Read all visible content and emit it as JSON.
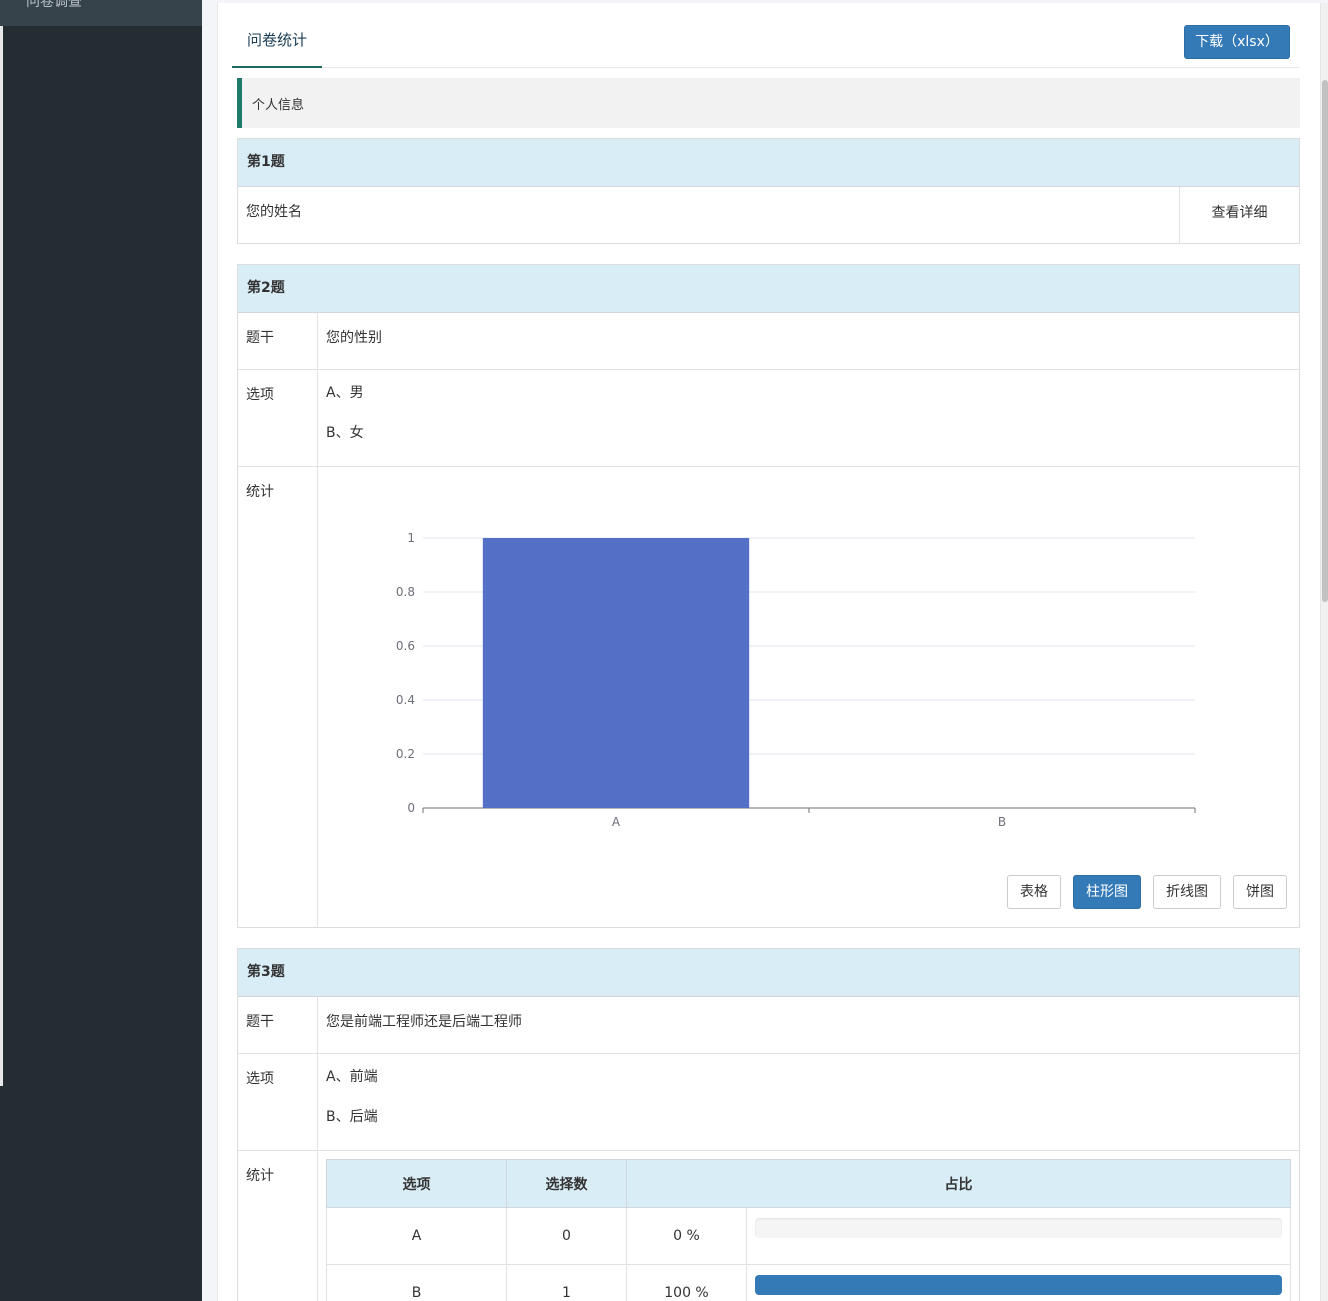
{
  "sidebar": {
    "item_label": "问卷调查"
  },
  "header": {
    "tab_label": "问卷统计",
    "download_label": "下载（xlsx）"
  },
  "section": {
    "title": "个人信息"
  },
  "labels": {
    "stem": "题干",
    "options": "选项",
    "stats": "统计"
  },
  "questions": [
    {
      "title": "第1题",
      "text": "您的姓名",
      "detail_label": "查看详细"
    },
    {
      "title": "第2题",
      "text": "您的性别",
      "options": [
        "A、男",
        "B、女"
      ],
      "chart_buttons": [
        {
          "label": "表格",
          "active": false
        },
        {
          "label": "柱形图",
          "active": true
        },
        {
          "label": "折线图",
          "active": false
        },
        {
          "label": "饼图",
          "active": false
        }
      ]
    },
    {
      "title": "第3题",
      "text": "您是前端工程师还是后端工程师",
      "options": [
        "A、前端",
        "B、后端"
      ],
      "table": {
        "headers": [
          "选项",
          "选择数",
          "占比"
        ],
        "rows": [
          {
            "option": "A",
            "count": "0",
            "percent": "0 %",
            "fraction": 0
          },
          {
            "option": "B",
            "count": "1",
            "percent": "100 %",
            "fraction": 1
          }
        ]
      }
    }
  ],
  "chart_data": {
    "type": "bar",
    "categories": [
      "A",
      "B"
    ],
    "values": [
      1,
      0
    ],
    "ylim": [
      0,
      1
    ],
    "yticks": [
      "0",
      "0.2",
      "0.4",
      "0.6",
      "0.8",
      "1"
    ],
    "grid": true,
    "bar_color": "#5470c6"
  }
}
